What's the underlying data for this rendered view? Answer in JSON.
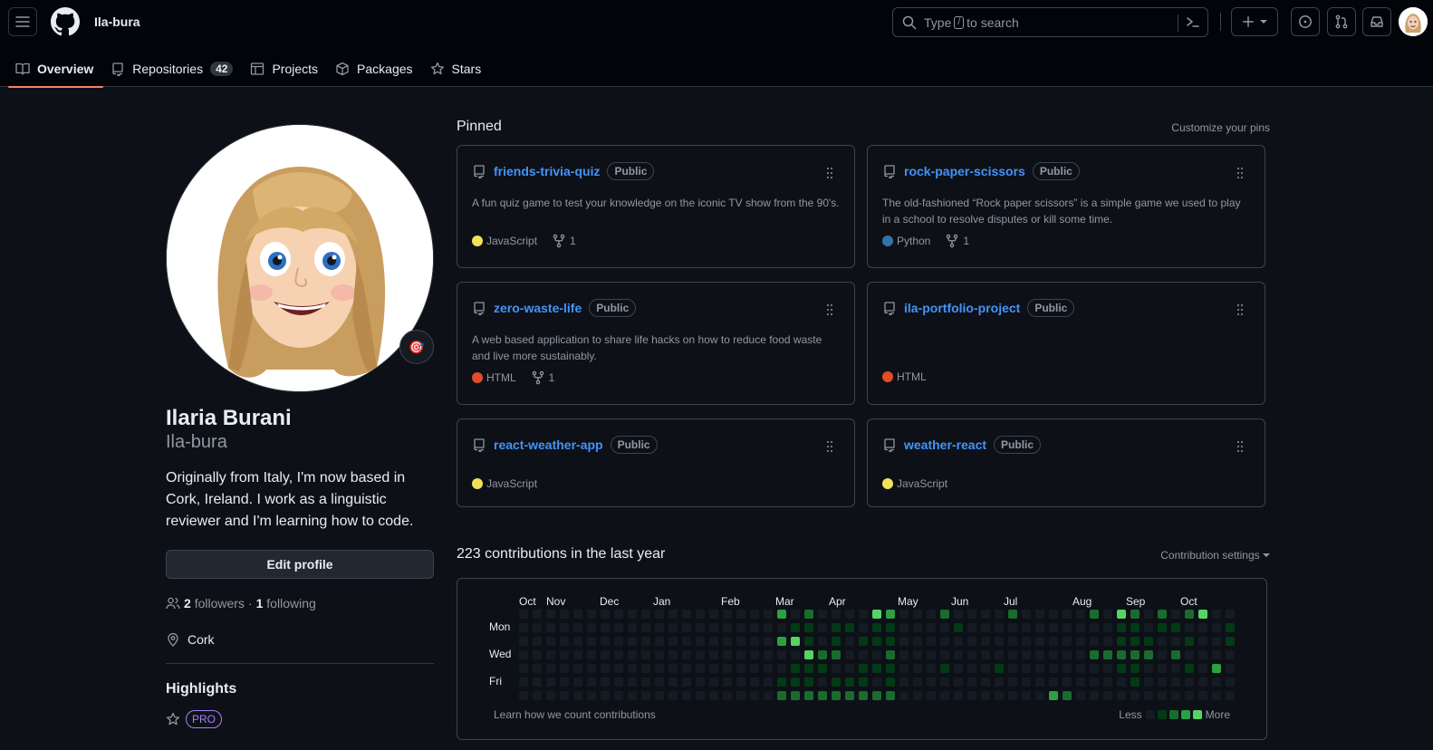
{
  "header": {
    "username": "Ila-bura",
    "search_placeholder_before": "Type",
    "search_key": "/",
    "search_placeholder_after": "to search"
  },
  "tabs": [
    {
      "label": "Overview"
    },
    {
      "label": "Repositories",
      "count": "42"
    },
    {
      "label": "Projects"
    },
    {
      "label": "Packages"
    },
    {
      "label": "Stars"
    }
  ],
  "profile": {
    "full_name": "Ilaria Burani",
    "login": "Ila-bura",
    "bio": "Originally from Italy, I'm now based in Cork, Ireland. I work as a linguistic reviewer and I'm learning how to code.",
    "edit_button": "Edit profile",
    "followers_count": "2",
    "followers_label": "followers",
    "separator": "·",
    "following_count": "1",
    "following_label": "following",
    "location": "Cork",
    "highlights_title": "Highlights",
    "pro_label": "PRO",
    "status_emoji": "🎯"
  },
  "pinned": {
    "title": "Pinned",
    "customize": "Customize your pins",
    "repos": [
      {
        "name": "friends-trivia-quiz",
        "visibility": "Public",
        "description": "A fun quiz game to test your knowledge on the iconic TV show from the 90's.",
        "language": "JavaScript",
        "language_color": "#f1e05a",
        "forks": "1"
      },
      {
        "name": "rock-paper-scissors",
        "visibility": "Public",
        "description": "The old-fashioned “Rock paper scissors” is a simple game we used to play in a school to resolve disputes or kill some time.",
        "language": "Python",
        "language_color": "#3572A5",
        "forks": "1"
      },
      {
        "name": "zero-waste-life",
        "visibility": "Public",
        "description": "A web based application to share life hacks on how to reduce food waste and live more sustainably.",
        "language": "HTML",
        "language_color": "#e34c26",
        "forks": "1"
      },
      {
        "name": "ila-portfolio-project",
        "visibility": "Public",
        "description": "",
        "language": "HTML",
        "language_color": "#e34c26",
        "forks": ""
      },
      {
        "name": "react-weather-app",
        "visibility": "Public",
        "description": "",
        "language": "JavaScript",
        "language_color": "#f1e05a",
        "forks": ""
      },
      {
        "name": "weather-react",
        "visibility": "Public",
        "description": "",
        "language": "JavaScript",
        "language_color": "#f1e05a",
        "forks": ""
      }
    ]
  },
  "contributions": {
    "title": "223 contributions in the last year",
    "settings": "Contribution settings",
    "months": [
      "Oct",
      "Nov",
      "Dec",
      "Jan",
      "Feb",
      "Mar",
      "Apr",
      "May",
      "Jun",
      "Jul",
      "Aug",
      "Sep",
      "Oct"
    ],
    "day_labels": [
      "Mon",
      "Wed",
      "Fri"
    ],
    "learn": "Learn how we count contributions",
    "less": "Less",
    "more": "More",
    "colors": [
      "#151b23",
      "#033a16",
      "#196c2e",
      "#2ea043",
      "#56d364"
    ]
  }
}
